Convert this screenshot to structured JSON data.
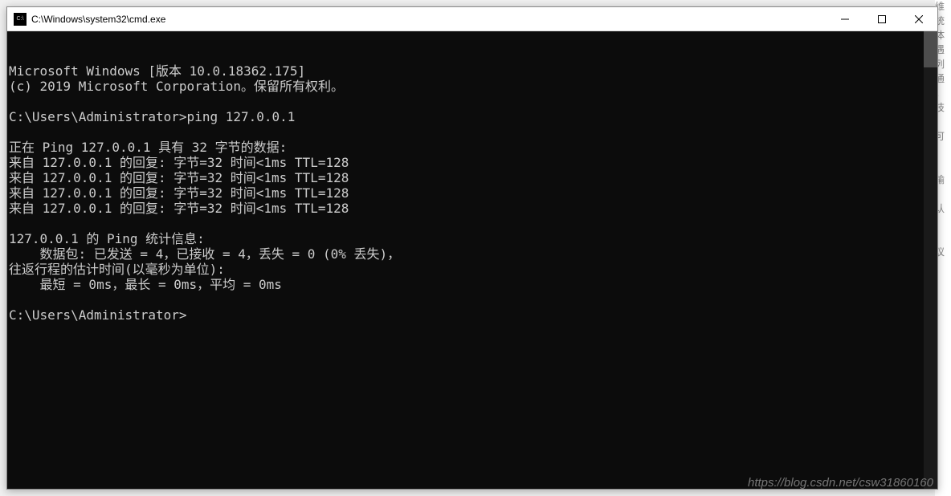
{
  "window": {
    "title": "C:\\Windows\\system32\\cmd.exe"
  },
  "console": {
    "lines": [
      "Microsoft Windows [版本 10.0.18362.175]",
      "(c) 2019 Microsoft Corporation。保留所有权利。",
      "",
      "C:\\Users\\Administrator>ping 127.0.0.1",
      "",
      "正在 Ping 127.0.0.1 具有 32 字节的数据:",
      "来自 127.0.0.1 的回复: 字节=32 时间<1ms TTL=128",
      "来自 127.0.0.1 的回复: 字节=32 时间<1ms TTL=128",
      "来自 127.0.0.1 的回复: 字节=32 时间<1ms TTL=128",
      "来自 127.0.0.1 的回复: 字节=32 时间<1ms TTL=128",
      "",
      "127.0.0.1 的 Ping 统计信息:",
      "    数据包: 已发送 = 4，已接收 = 4，丢失 = 0 (0% 丢失)，",
      "往返行程的估计时间(以毫秒为单位):",
      "    最短 = 0ms，最长 = 0ms，平均 = 0ms",
      "",
      "C:\\Users\\Administrator>"
    ]
  },
  "bg_fragments": [
    "维",
    "统",
    "体",
    "遇",
    "列",
    "通",
    "。",
    "技",
    "",
    "可",
    "",
    "",
    "输",
    "",
    "认",
    "",
    "",
    "议"
  ],
  "watermark": "https://blog.csdn.net/csw31860160"
}
